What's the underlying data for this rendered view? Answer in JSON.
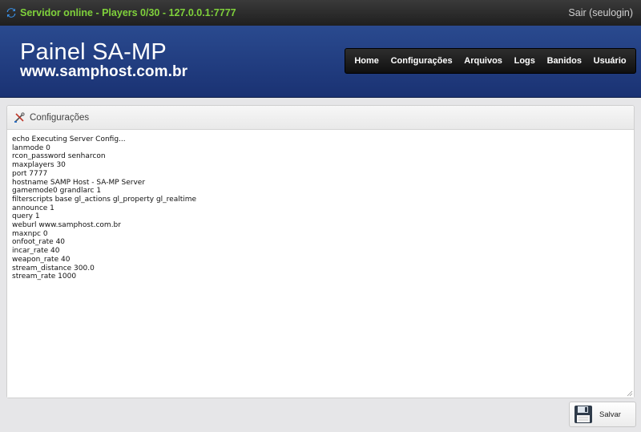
{
  "topbar": {
    "status_icon": "refresh-icon",
    "status_text": "Servidor online - Players 0/30 - 127.0.0.1:7777",
    "logout_label": "Sair (seulogin)"
  },
  "brand": {
    "title": "Painel SA-MP",
    "url": "www.samphost.com.br"
  },
  "nav": {
    "items": [
      {
        "label": "Home"
      },
      {
        "label": "Configurações"
      },
      {
        "label": "Arquivos"
      },
      {
        "label": "Logs"
      },
      {
        "label": "Banidos"
      },
      {
        "label": "Usuário"
      }
    ]
  },
  "panel": {
    "icon": "tools-icon",
    "title": "Configurações",
    "config_text": "echo Executing Server Config...\nlanmode 0\nrcon_password senharcon\nmaxplayers 30\nport 7777\nhostname SAMP Host - SA-MP Server\ngamemode0 grandlarc 1\nfilterscripts base gl_actions gl_property gl_realtime\nannounce 1\nquery 1\nweburl www.samphost.com.br\nmaxnpc 0\nonfoot_rate 40\nincar_rate 40\nweapon_rate 40\nstream_distance 300.0\nstream_rate 1000"
  },
  "save_button": {
    "icon": "floppy-disk-icon",
    "label": "Salvar"
  },
  "colors": {
    "status_green": "#7fd13b",
    "header_blue": "#1f3a7e",
    "nav_dark": "#1a1a1a"
  }
}
